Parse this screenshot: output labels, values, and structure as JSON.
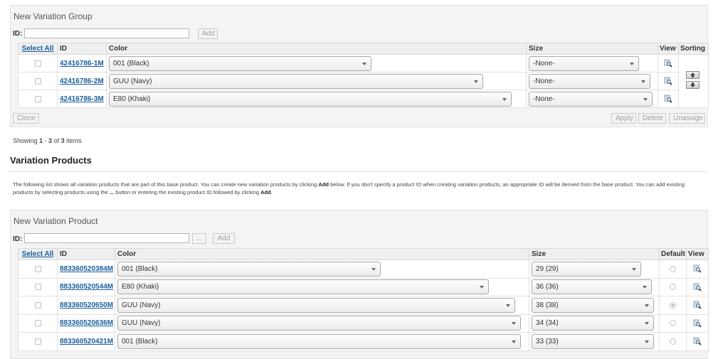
{
  "group": {
    "title": "New Variation Group",
    "id_label": "ID:",
    "id_value": "",
    "add_label": "Add",
    "headers": {
      "select_all": "Select All",
      "id": "ID",
      "color": "Color",
      "size": "Size",
      "view": "View",
      "sorting": "Sorting"
    },
    "rows": [
      {
        "id": "42416786-1M",
        "color": "001 (Black)",
        "size": "-None-"
      },
      {
        "id": "42416786-2M",
        "color": "GUU (Navy)",
        "size": "-None-"
      },
      {
        "id": "42416786-3M",
        "color": "E80 (Khaki)",
        "size": "-None-"
      }
    ],
    "clone_label": "Clone",
    "apply_label": "Apply",
    "delete_label": "Delete",
    "unassign_label": "Unassign"
  },
  "showing": {
    "prefix": "Showing ",
    "from": "1",
    "dash": " - ",
    "to": "3",
    "of": " of ",
    "total": "3",
    "suffix": " items"
  },
  "variation_products": {
    "title": "Variation Products",
    "desc_1": "The following list shows all variation products that are part of this base product. You can create new variation products by clicking ",
    "desc_add_1": "Add",
    "desc_2": " below. If you don't specify a product ID when creating variation products, an appropriate ID will be derived from the base product. You can add existing products by selecting products using the ",
    "desc_dots": "...",
    "desc_3": " button or entering the existing product ID followed by clicking ",
    "desc_add_2": "Add",
    "desc_4": "."
  },
  "product": {
    "title": "New Variation Product",
    "id_label": "ID:",
    "id_value": "",
    "browse_label": "...",
    "add_label": "Add",
    "headers": {
      "select_all": "Select All",
      "id": "ID",
      "color": "Color",
      "size": "Size",
      "default": "Default",
      "view": "View"
    },
    "rows": [
      {
        "id": "883360520384M",
        "color": "001 (Black)",
        "size": "29 (29)",
        "default": false
      },
      {
        "id": "883360520544M",
        "color": "E80 (Khaki)",
        "size": "36 (36)",
        "default": false
      },
      {
        "id": "883360520650M",
        "color": "GUU (Navy)",
        "size": "38 (38)",
        "default": true
      },
      {
        "id": "883360520636M",
        "color": "GUU (Navy)",
        "size": "34 (34)",
        "default": false
      },
      {
        "id": "883360520421M",
        "color": "001 (Black)",
        "size": "33 (33)",
        "default": false
      }
    ]
  },
  "icons": {
    "view": "view-magnifier-icon",
    "sort_up": "sort-up-icon",
    "sort_down": "sort-down-icon"
  }
}
